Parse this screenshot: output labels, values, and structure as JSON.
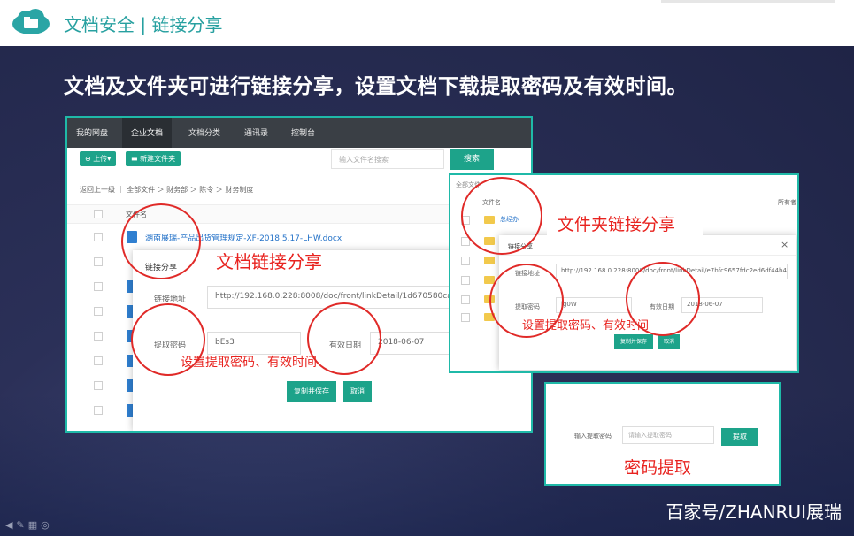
{
  "header": {
    "section_title": "文档安全 | 链接分享",
    "headline": "文档及文件夹可进行链接分享，设置文档下载提取密码及有效时间。"
  },
  "left_screenshot": {
    "nav_tabs": [
      "我的网盘",
      "企业文档",
      "文档分类",
      "通讯录",
      "控制台"
    ],
    "active_tab": "企业文档",
    "upload_label": "上传▾",
    "new_folder_label": "新建文件夹",
    "search_placeholder": "输入文件名搜索",
    "search_button": "搜索",
    "breadcrumb": "返回上一级 ｜ 全部文件 ＞ 财务部 ＞ 陈令 ＞ 财务制度",
    "column_name": "文件名",
    "file_name": "湖南展瑞-产品出货管理规定-XF-2018.5.17-LHW.docx",
    "modal": {
      "title": "链接分享",
      "link_label": "链接地址",
      "link_value": "http://192.168.0.228:8008/doc/front/linkDetail/1d670580ca19",
      "password_label": "提取密码",
      "password_value": "bEs3",
      "valid_label": "有效日期",
      "valid_value": "2018-06-07",
      "copy_save": "复制并保存",
      "cancel": "取消"
    },
    "annotation_title": "文档链接分享",
    "annotation_settings": "设置提取密码、有效时间"
  },
  "right_top_screenshot": {
    "all_files": "全部文件",
    "column_name": "文件名",
    "column_owner": "所有者",
    "first_folder": "总经办",
    "modal": {
      "title": "链接分享",
      "close": "×",
      "link_label": "链接地址",
      "link_value": "http://192.168.0.228:8008/doc/front/linkDetail/e7bfc9657fdc2ed6df44b4ca0e",
      "password_label": "提取密码",
      "password_value": "lg0W",
      "valid_label": "有效日期",
      "valid_value": "2018-06-07",
      "copy_save": "复制并保存",
      "cancel": "取消"
    },
    "annotation_title": "文件夹链接分享",
    "annotation_settings": "设置提取密码、有效时间"
  },
  "right_bottom_screenshot": {
    "input_label": "输入提取密码",
    "input_placeholder": "请输入提取密码",
    "extract_button": "提取",
    "annotation_title": "密码提取"
  },
  "watermark": "百家号/ZHANRUI展瑞",
  "colors": {
    "brand_teal": "#27a0a0",
    "button_green": "#1da38a",
    "annotation_red": "#e8231f",
    "background": "#262a4c"
  }
}
